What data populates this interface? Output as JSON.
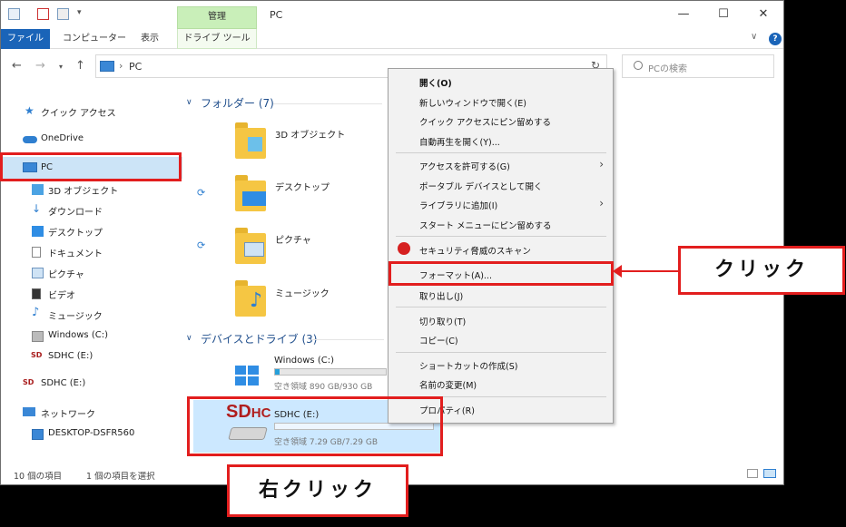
{
  "window": {
    "title": "PC",
    "controls": {
      "minimize": "—",
      "maximize": "☐",
      "close": "✕"
    }
  },
  "ribbon": {
    "context_group": "管理",
    "tabs": [
      {
        "label": "ファイル"
      },
      {
        "label": "コンピューター"
      },
      {
        "label": "表示"
      },
      {
        "label": "ドライブ ツール"
      }
    ],
    "help": "?"
  },
  "address": {
    "path": "PC",
    "search_placeholder": "PCの検索"
  },
  "navpane": {
    "items": [
      {
        "label": "クイック アクセス",
        "icon": "star-icon"
      },
      {
        "label": "OneDrive",
        "icon": "cloud-icon"
      },
      {
        "label": "PC",
        "icon": "pc-icon"
      },
      {
        "label": "3D オブジェクト",
        "icon": "cube-icon"
      },
      {
        "label": "ダウンロード",
        "icon": "download-icon"
      },
      {
        "label": "デスクトップ",
        "icon": "desktop-icon"
      },
      {
        "label": "ドキュメント",
        "icon": "document-icon"
      },
      {
        "label": "ピクチャ",
        "icon": "picture-icon"
      },
      {
        "label": "ビデオ",
        "icon": "video-icon"
      },
      {
        "label": "ミュージック",
        "icon": "music-icon"
      },
      {
        "label": "Windows (C:)",
        "icon": "windows-drive-icon"
      },
      {
        "label": "SDHC (E:)",
        "icon": "sd-icon"
      },
      {
        "label": "SDHC (E:)",
        "icon": "sd-icon"
      },
      {
        "label": "ネットワーク",
        "icon": "network-icon"
      },
      {
        "label": "DESKTOP-DSFR560",
        "icon": "computer-icon"
      }
    ]
  },
  "content": {
    "folders_header": "フォルダー (7)",
    "folders": [
      {
        "label": "3D オブジェクト"
      },
      {
        "label": "デスクトップ"
      },
      {
        "label": "ピクチャ"
      },
      {
        "label": "ミュージック"
      }
    ],
    "devices_header": "デバイスとドライブ (3)",
    "drives": [
      {
        "label": "Windows (C:)",
        "space": "空き領域 890 GB/930 GB",
        "used_fraction": 0.04
      },
      {
        "label": "SDHC (E:)",
        "space": "空き領域 7.29 GB/7.29 GB",
        "used_fraction": 0.0,
        "logo": "SDHC"
      }
    ]
  },
  "context_menu": {
    "items": [
      "開く(O)",
      "新しいウィンドウで開く(E)",
      "クイック アクセスにピン留めする",
      "自動再生を開く(Y)...",
      "アクセスを許可する(G)",
      "ポータブル デバイスとして開く",
      "ライブラリに追加(I)",
      "スタート メニューにピン留めする",
      "セキュリティ脅威のスキャン",
      "フォーマット(A)...",
      "取り出し(J)",
      "切り取り(T)",
      "コピー(C)",
      "ショートカットの作成(S)",
      "名前の変更(M)",
      "プロパティ(R)"
    ]
  },
  "status": {
    "count": "10 個の項目",
    "selected": "1 個の項目を選択"
  },
  "annotations": {
    "click": "クリック",
    "right_click": "右クリック"
  },
  "colors": {
    "highlight_red": "#e21e1e",
    "file_tab_blue": "#1a64b8",
    "context_tab_green": "#c9efb9",
    "selection_blue": "#cce4f7"
  }
}
